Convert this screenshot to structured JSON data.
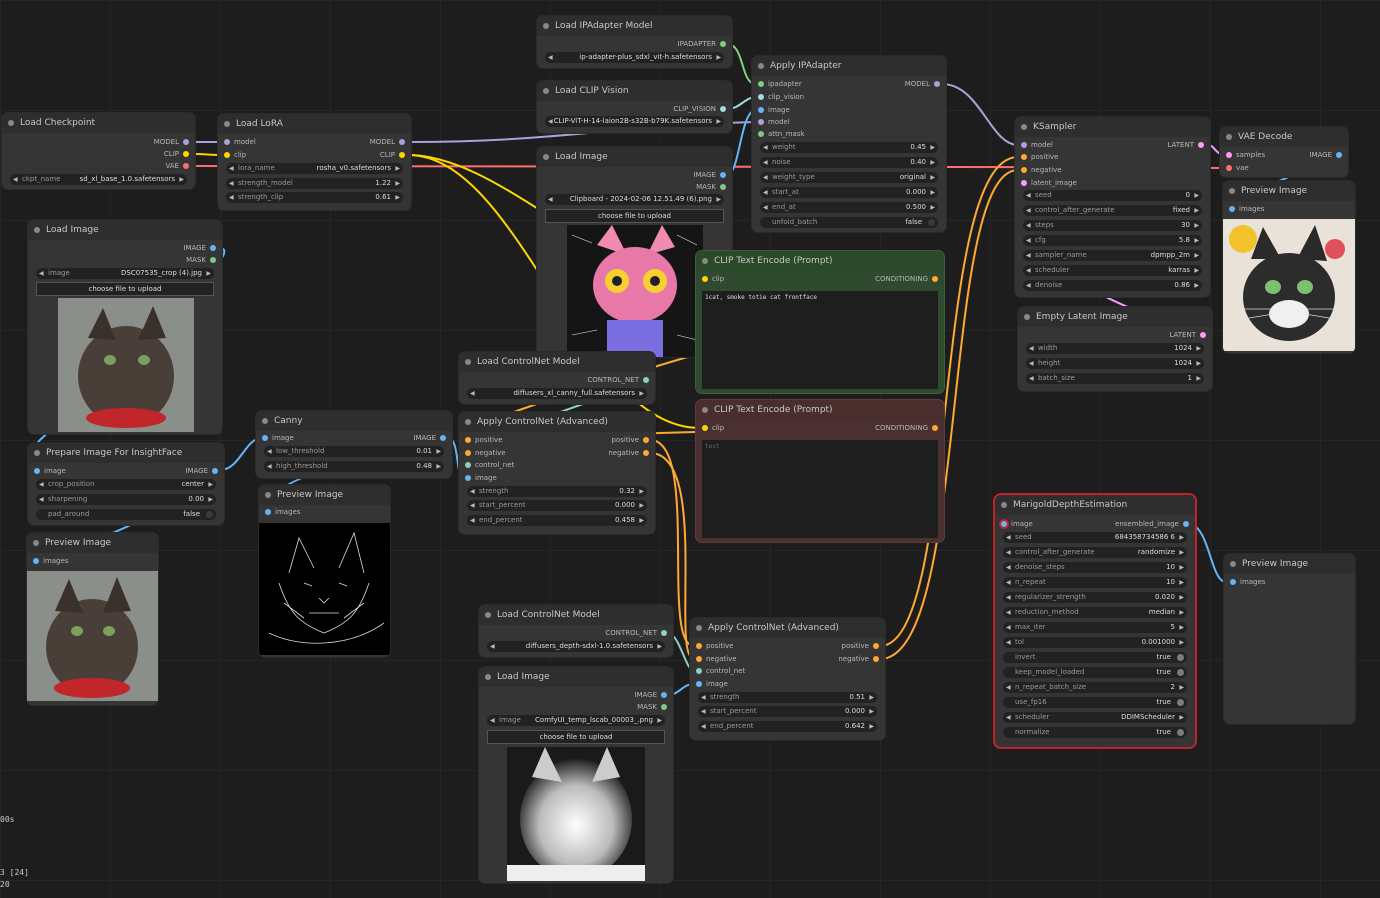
{
  "colors": {
    "model": "#b39ddb",
    "clip": "#ffd500",
    "vae": "#ff6e6e",
    "image": "#64b5f6",
    "mask": "#81c784",
    "latent": "#ff9cf9",
    "conditioning": "#ffa931",
    "control_net": "#8ecfbf",
    "ipadapter": "#7bd37b",
    "clip_vision": "#a8dadc"
  },
  "nodes": {
    "load_checkpoint": {
      "title": "Load Checkpoint",
      "out_model": "MODEL",
      "out_clip": "CLIP",
      "out_vae": "VAE",
      "w_ckpt_label": "ckpt_name",
      "w_ckpt_value": "sd_xl_base_1.0.safetensors"
    },
    "load_lora": {
      "title": "Load LoRA",
      "in_model": "model",
      "in_clip": "clip",
      "out_model": "MODEL",
      "out_clip": "CLIP",
      "w1_label": "lora_name",
      "w1_value": "rosha_v0.safetensors",
      "w2_label": "strength_model",
      "w2_value": "1.22",
      "w3_label": "strength_clip",
      "w3_value": "0.61"
    },
    "load_image_1": {
      "title": "Load Image",
      "out_image": "IMAGE",
      "out_mask": "MASK",
      "w_label": "image",
      "w_value": "DSC07535_crop (4).jpg",
      "upload": "choose file to upload"
    },
    "prep_insight": {
      "title": "Prepare Image For InsightFace",
      "in_image": "image",
      "out_image": "IMAGE",
      "w1_label": "crop_position",
      "w1_value": "center",
      "w2_label": "sharpening",
      "w2_value": "0.00",
      "w3_label": "pad_around",
      "w3_value": "false"
    },
    "preview_1": {
      "title": "Preview Image",
      "in_images": "images"
    },
    "canny": {
      "title": "Canny",
      "in_image": "image",
      "out_image": "IMAGE",
      "w1_label": "low_threshold",
      "w1_value": "0.01",
      "w2_label": "high_threshold",
      "w2_value": "0.48"
    },
    "preview_canny": {
      "title": "Preview Image",
      "in_images": "images"
    },
    "load_ipadapter_model": {
      "title": "Load IPAdapter Model",
      "out": "IPADAPTER",
      "w_label": "ipadapter_file",
      "w_value": "ip-adapter-plus_sdxl_vit-h.safetensors"
    },
    "load_clip_vision": {
      "title": "Load CLIP Vision",
      "out": "CLIP_VISION",
      "w_label": "clip_name",
      "w_value": "CLIP-ViT-H-14-laion2B-s32B-b79K.safetensors"
    },
    "load_image_2": {
      "title": "Load Image",
      "out_image": "IMAGE",
      "out_mask": "MASK",
      "w_label": "image",
      "w_value": "Clipboard - 2024-02-06 12.51.49 (6).png",
      "upload": "choose file to upload"
    },
    "apply_ipadapter": {
      "title": "Apply IPAdapter",
      "in1": "ipadapter",
      "in2": "clip_vision",
      "in3": "image",
      "in4": "model",
      "in5": "attn_mask",
      "out_model": "MODEL",
      "w1_label": "weight",
      "w1_value": "0.45",
      "w2_label": "noise",
      "w2_value": "0.40",
      "w3_label": "weight_type",
      "w3_value": "original",
      "w4_label": "start_at",
      "w4_value": "0.000",
      "w5_label": "end_at",
      "w5_value": "0.500",
      "w6_label": "unfold_batch",
      "w6_value": "false"
    },
    "load_controlnet_1": {
      "title": "Load ControlNet Model",
      "out": "CONTROL_NET",
      "w_label": "control_net_name",
      "w_value": "diffusers_xl_canny_full.safetensors"
    },
    "apply_controlnet_1": {
      "title": "Apply ControlNet (Advanced)",
      "in1": "positive",
      "in2": "negative",
      "in3": "control_net",
      "in4": "image",
      "out1": "positive",
      "out2": "negative",
      "w1_label": "strength",
      "w1_value": "0.32",
      "w2_label": "start_percent",
      "w2_value": "0.000",
      "w3_label": "end_percent",
      "w3_value": "0.458"
    },
    "clip_pos": {
      "title": "CLIP Text Encode (Prompt)",
      "in_clip": "clip",
      "out": "CONDITIONING",
      "text": "1cat, smoke totie cat frontface"
    },
    "clip_neg": {
      "title": "CLIP Text Encode (Prompt)",
      "in_clip": "clip",
      "out": "CONDITIONING",
      "placeholder": "text"
    },
    "load_controlnet_2": {
      "title": "Load ControlNet Model",
      "out": "CONTROL_NET",
      "w_label": "control_net_name",
      "w_value": "diffusers_depth-sdxl-1.0.safetensors"
    },
    "load_image_3": {
      "title": "Load Image",
      "out_image": "IMAGE",
      "out_mask": "MASK",
      "w_label": "image",
      "w_value": "ComfyUI_temp_lscab_00003_.png",
      "upload": "choose file to upload"
    },
    "apply_controlnet_2": {
      "title": "Apply ControlNet (Advanced)",
      "in1": "positive",
      "in2": "negative",
      "in3": "control_net",
      "in4": "image",
      "out1": "positive",
      "out2": "negative",
      "w1_label": "strength",
      "w1_value": "0.51",
      "w2_label": "start_percent",
      "w2_value": "0.000",
      "w3_label": "end_percent",
      "w3_value": "0.642"
    },
    "ksampler": {
      "title": "KSampler",
      "in1": "model",
      "in2": "positive",
      "in3": "negative",
      "in4": "latent_image",
      "out": "LATENT",
      "w1_label": "seed",
      "w1_value": "0",
      "w2_label": "control_after_generate",
      "w2_value": "fixed",
      "w3_label": "steps",
      "w3_value": "30",
      "w4_label": "cfg",
      "w4_value": "5.8",
      "w5_label": "sampler_name",
      "w5_value": "dpmpp_2m",
      "w6_label": "scheduler",
      "w6_value": "karras",
      "w7_label": "denoise",
      "w7_value": "0.86"
    },
    "empty_latent": {
      "title": "Empty Latent Image",
      "out": "LATENT",
      "w1_label": "width",
      "w1_value": "1024",
      "w2_label": "height",
      "w2_value": "1024",
      "w3_label": "batch_size",
      "w3_value": "1"
    },
    "vae_decode": {
      "title": "VAE Decode",
      "in1": "samples",
      "in2": "vae",
      "out": "IMAGE"
    },
    "preview_final": {
      "title": "Preview Image",
      "in_images": "images"
    },
    "marigold": {
      "title": "MarigoldDepthEstimation",
      "in_image": "image",
      "out": "ensembled_image",
      "w1_label": "seed",
      "w1_value": "684358734586 6",
      "w2_label": "control_after_generate",
      "w2_value": "randomize",
      "w3_label": "denoise_steps",
      "w3_value": "10",
      "w4_label": "n_repeat",
      "w4_value": "10",
      "w5_label": "regularizer_strength",
      "w5_value": "0.020",
      "w6_label": "reduction_method",
      "w6_value": "median",
      "w7_label": "max_iter",
      "w7_value": "5",
      "w8_label": "tol",
      "w8_value": "0.001000",
      "w9_label": "invert",
      "w9_value": "true",
      "w10_label": "keep_model_loaded",
      "w10_value": "true",
      "w11_label": "n_repeat_batch_size",
      "w11_value": "2",
      "w12_label": "use_fp16",
      "w12_value": "true",
      "w13_label": "scheduler",
      "w13_value": "DDIMScheduler",
      "w14_label": "normalize",
      "w14_value": "true"
    },
    "preview_marigold": {
      "title": "Preview Image",
      "in_images": "images"
    }
  },
  "stats": {
    "l1": "00s",
    "l2": "3 [24]",
    "l3": "20"
  }
}
